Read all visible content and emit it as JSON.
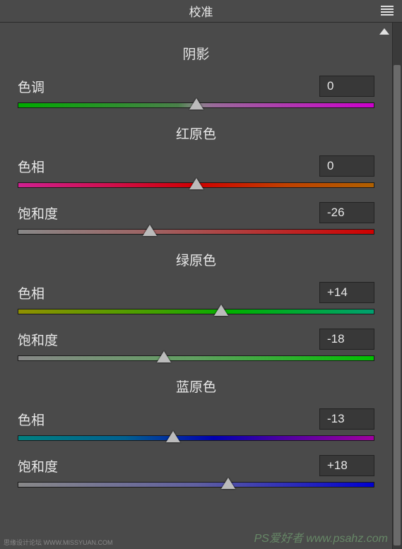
{
  "header": {
    "title": "校准"
  },
  "sections": {
    "shadow": {
      "title": "阴影",
      "tint": {
        "label": "色调",
        "value": "0",
        "position": 50
      }
    },
    "red": {
      "title": "红原色",
      "hue": {
        "label": "色相",
        "value": "0",
        "position": 50
      },
      "sat": {
        "label": "饱和度",
        "value": "-26",
        "position": 37
      }
    },
    "green": {
      "title": "绿原色",
      "hue": {
        "label": "色相",
        "value": "+14",
        "position": 57
      },
      "sat": {
        "label": "饱和度",
        "value": "-18",
        "position": 41
      }
    },
    "blue": {
      "title": "蓝原色",
      "hue": {
        "label": "色相",
        "value": "-13",
        "position": 43.5
      },
      "sat": {
        "label": "饱和度",
        "value": "+18",
        "position": 59
      }
    }
  },
  "watermark": {
    "left": "思缘设计论坛 WWW.MISSYUAN.COM",
    "right": "PS爱好者 www.psahz.com"
  }
}
